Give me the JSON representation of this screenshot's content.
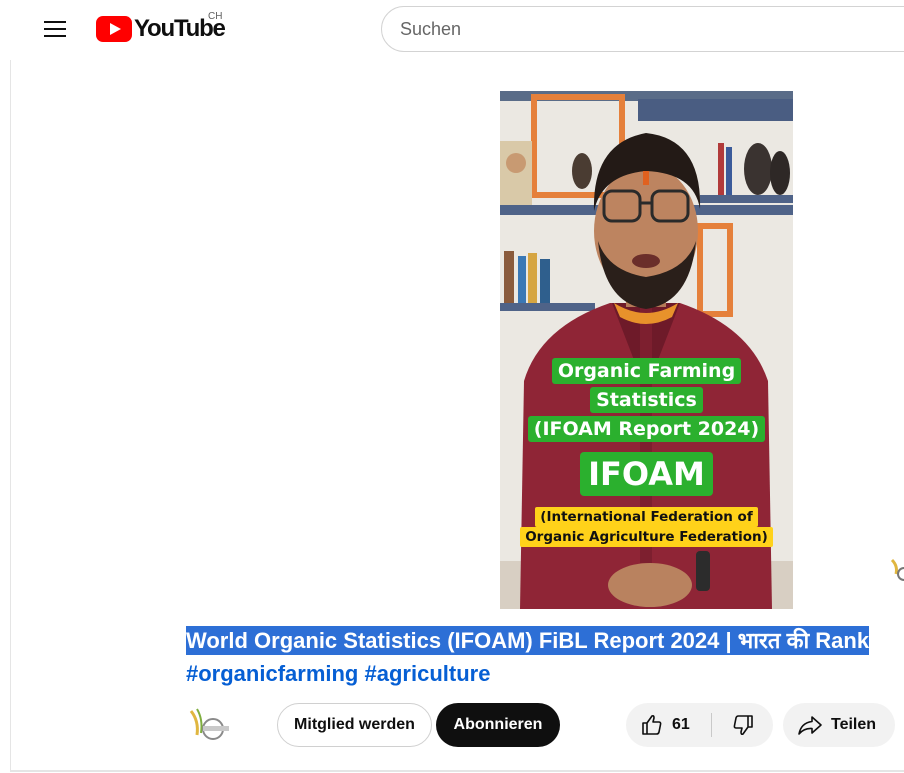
{
  "masthead": {
    "logo_text": "YouTube",
    "country_code": "CH",
    "search_placeholder": "Suchen",
    "menu_icon": "hamburger-menu-icon"
  },
  "video": {
    "caption_lines": [
      "Organic Farming",
      "Statistics",
      "(IFOAM Report 2024)"
    ],
    "caption_big": "IFOAM",
    "caption_sub_lines": [
      "(International Federation of",
      "Organic Agriculture Federation)"
    ],
    "colors": {
      "caption_green": "#2bb02e",
      "caption_yellow": "#ffd21a"
    }
  },
  "title": {
    "text": "World Organic Statistics (IFOAM) FiBL Report 2024 | भारत की Rank",
    "hashtags": [
      "#organicfarming",
      "#agriculture"
    ]
  },
  "actions": {
    "join_label": "Mitglied werden",
    "subscribe_label": "Abonnieren",
    "like_count": "61",
    "share_label": "Teilen",
    "like_icon": "thumbs-up-icon",
    "dislike_icon": "thumbs-down-icon",
    "share_icon": "share-arrow-icon"
  },
  "colors": {
    "brand_red": "#ff0000",
    "link_blue": "#065fd4",
    "selection_blue": "#2d6fd6"
  }
}
